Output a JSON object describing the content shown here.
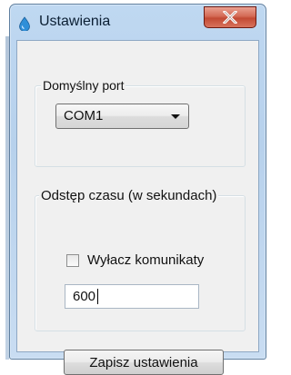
{
  "window": {
    "title": "Ustawienia",
    "icon": "water-drop-icon",
    "close_icon": "close-x-icon"
  },
  "port_group": {
    "label": "Domyślny port",
    "selected_port": "COM1"
  },
  "interval_group": {
    "label": "Odstęp czasu (w sekundach)",
    "checkbox_label": "Wyłacz komunikaty",
    "checkbox_checked": false,
    "interval_value": "600"
  },
  "actions": {
    "save_label": "Zapisz ustawienia"
  },
  "colors": {
    "titlebar": "#bfd8f1",
    "close_button": "#c24a34",
    "client": "#f0f0f0"
  }
}
